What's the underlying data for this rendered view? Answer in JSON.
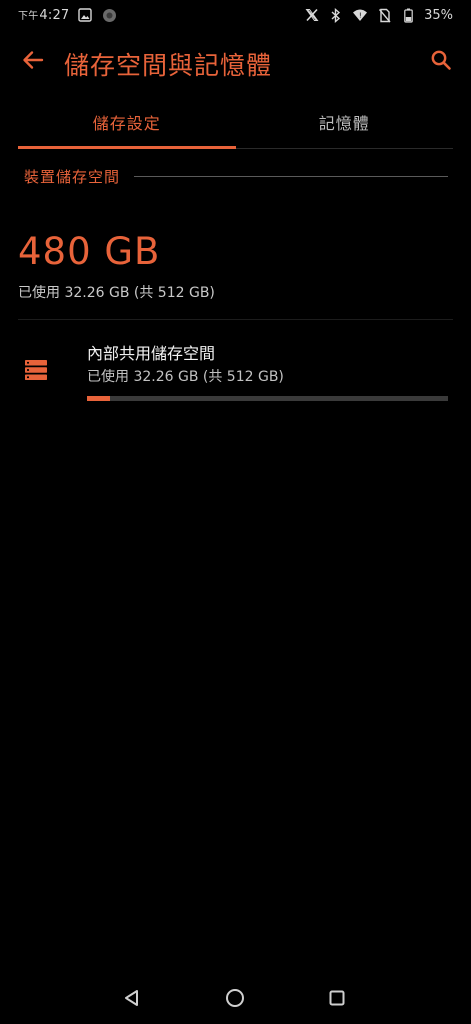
{
  "status_bar": {
    "ampm": "下午",
    "time": "4:27",
    "battery_percent": "35%",
    "icons": [
      "image-icon",
      "app-notification-icon",
      "x-twitter-icon",
      "bluetooth-icon",
      "wifi-icon",
      "no-sim-icon",
      "battery-icon"
    ]
  },
  "app_bar": {
    "title": "儲存空間與記憶體",
    "back_icon": "arrow-left-icon",
    "search_icon": "search-icon"
  },
  "tabs": [
    {
      "label": "儲存設定",
      "active": true
    },
    {
      "label": "記憶體",
      "active": false
    }
  ],
  "section": {
    "title": "裝置儲存空間"
  },
  "summary": {
    "total": "480 GB",
    "used_text": "已使用 32.26 GB (共 512 GB)"
  },
  "storage_items": [
    {
      "title": "內部共用儲存空間",
      "used_text": "已使用 32.26 GB (共 512 GB)",
      "used_fraction": 0.063,
      "icon": "storage-icon"
    }
  ],
  "nav_bar": {
    "icons": [
      "back-triangle-icon",
      "home-circle-icon",
      "recents-square-icon"
    ]
  },
  "colors": {
    "accent": "#e8633a",
    "background": "#000000",
    "track": "#3a3a3a"
  }
}
